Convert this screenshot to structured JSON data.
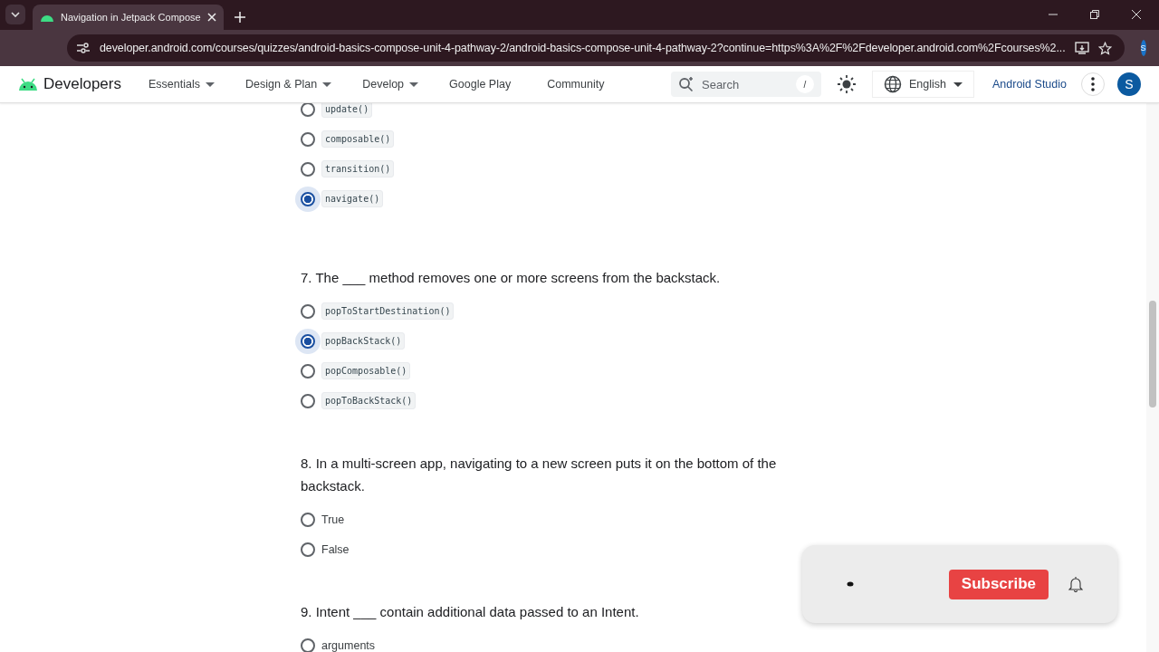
{
  "browser": {
    "tab": {
      "title": "Navigation in Jetpack Compose",
      "selected": true
    },
    "url": "developer.android.com/courses/quizzes/android-basics-compose-unit-4-pathway-2/android-basics-compose-unit-4-pathway-2?continue=https%3A%2F%2Fdeveloper.android.com%2Fcourses%2...",
    "profile": "S"
  },
  "site_header": {
    "brand": "Developers",
    "nav": [
      {
        "label": "Essentials",
        "dropdown": true
      },
      {
        "label": "Design & Plan",
        "dropdown": true
      },
      {
        "label": "Develop",
        "dropdown": true
      },
      {
        "label": "Google Play",
        "dropdown": false
      },
      {
        "label": "Community",
        "dropdown": false
      }
    ],
    "search": {
      "placeholder": "Search",
      "shortcut": "/"
    },
    "language": "English",
    "studio_link": "Android Studio",
    "avatar": "S"
  },
  "questions": [
    {
      "options": [
        {
          "label": "update()",
          "code": true,
          "selected": false
        },
        {
          "label": "composable()",
          "code": true,
          "selected": false
        },
        {
          "label": "transition()",
          "code": true,
          "selected": false
        },
        {
          "label": "navigate()",
          "code": true,
          "selected": true
        }
      ]
    },
    {
      "text": "7. The ___ method removes one or more screens from the backstack.",
      "options": [
        {
          "label": "popToStartDestination()",
          "code": true,
          "selected": false
        },
        {
          "label": "popBackStack()",
          "code": true,
          "selected": true
        },
        {
          "label": "popComposable()",
          "code": true,
          "selected": false
        },
        {
          "label": "popToBackStack()",
          "code": true,
          "selected": false
        }
      ]
    },
    {
      "text": "8. In a multi-screen app, navigating to a new screen puts it on the bottom of the backstack.",
      "options": [
        {
          "label": "True",
          "code": false,
          "selected": false
        },
        {
          "label": "False",
          "code": false,
          "selected": false
        }
      ]
    },
    {
      "text": "9. Intent ___ contain additional data passed to an Intent.",
      "options": [
        {
          "label": "arguments",
          "code": false,
          "selected": false
        }
      ]
    }
  ],
  "overlay": {
    "button": "Subscribe"
  }
}
